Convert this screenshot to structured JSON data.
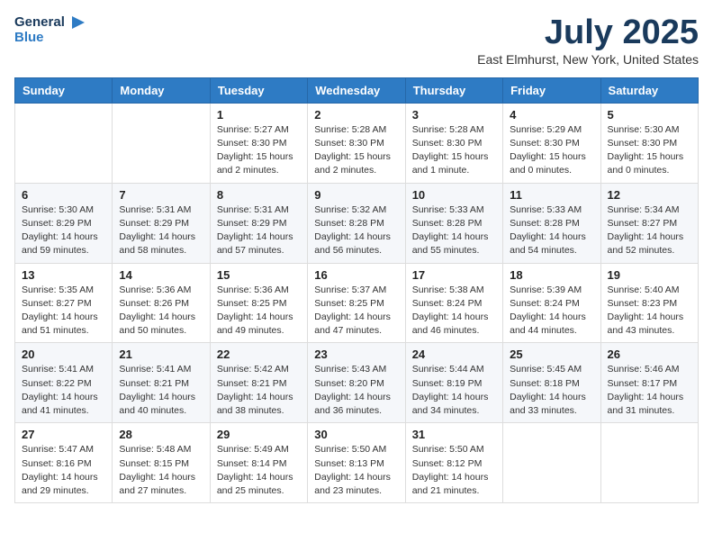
{
  "header": {
    "logo_line1": "General",
    "logo_line2": "Blue",
    "month_title": "July 2025",
    "location": "East Elmhurst, New York, United States"
  },
  "days_of_week": [
    "Sunday",
    "Monday",
    "Tuesday",
    "Wednesday",
    "Thursday",
    "Friday",
    "Saturday"
  ],
  "weeks": [
    [
      {
        "day": "",
        "info": ""
      },
      {
        "day": "",
        "info": ""
      },
      {
        "day": "1",
        "info": "Sunrise: 5:27 AM\nSunset: 8:30 PM\nDaylight: 15 hours and 2 minutes."
      },
      {
        "day": "2",
        "info": "Sunrise: 5:28 AM\nSunset: 8:30 PM\nDaylight: 15 hours and 2 minutes."
      },
      {
        "day": "3",
        "info": "Sunrise: 5:28 AM\nSunset: 8:30 PM\nDaylight: 15 hours and 1 minute."
      },
      {
        "day": "4",
        "info": "Sunrise: 5:29 AM\nSunset: 8:30 PM\nDaylight: 15 hours and 0 minutes."
      },
      {
        "day": "5",
        "info": "Sunrise: 5:30 AM\nSunset: 8:30 PM\nDaylight: 15 hours and 0 minutes."
      }
    ],
    [
      {
        "day": "6",
        "info": "Sunrise: 5:30 AM\nSunset: 8:29 PM\nDaylight: 14 hours and 59 minutes."
      },
      {
        "day": "7",
        "info": "Sunrise: 5:31 AM\nSunset: 8:29 PM\nDaylight: 14 hours and 58 minutes."
      },
      {
        "day": "8",
        "info": "Sunrise: 5:31 AM\nSunset: 8:29 PM\nDaylight: 14 hours and 57 minutes."
      },
      {
        "day": "9",
        "info": "Sunrise: 5:32 AM\nSunset: 8:28 PM\nDaylight: 14 hours and 56 minutes."
      },
      {
        "day": "10",
        "info": "Sunrise: 5:33 AM\nSunset: 8:28 PM\nDaylight: 14 hours and 55 minutes."
      },
      {
        "day": "11",
        "info": "Sunrise: 5:33 AM\nSunset: 8:28 PM\nDaylight: 14 hours and 54 minutes."
      },
      {
        "day": "12",
        "info": "Sunrise: 5:34 AM\nSunset: 8:27 PM\nDaylight: 14 hours and 52 minutes."
      }
    ],
    [
      {
        "day": "13",
        "info": "Sunrise: 5:35 AM\nSunset: 8:27 PM\nDaylight: 14 hours and 51 minutes."
      },
      {
        "day": "14",
        "info": "Sunrise: 5:36 AM\nSunset: 8:26 PM\nDaylight: 14 hours and 50 minutes."
      },
      {
        "day": "15",
        "info": "Sunrise: 5:36 AM\nSunset: 8:25 PM\nDaylight: 14 hours and 49 minutes."
      },
      {
        "day": "16",
        "info": "Sunrise: 5:37 AM\nSunset: 8:25 PM\nDaylight: 14 hours and 47 minutes."
      },
      {
        "day": "17",
        "info": "Sunrise: 5:38 AM\nSunset: 8:24 PM\nDaylight: 14 hours and 46 minutes."
      },
      {
        "day": "18",
        "info": "Sunrise: 5:39 AM\nSunset: 8:24 PM\nDaylight: 14 hours and 44 minutes."
      },
      {
        "day": "19",
        "info": "Sunrise: 5:40 AM\nSunset: 8:23 PM\nDaylight: 14 hours and 43 minutes."
      }
    ],
    [
      {
        "day": "20",
        "info": "Sunrise: 5:41 AM\nSunset: 8:22 PM\nDaylight: 14 hours and 41 minutes."
      },
      {
        "day": "21",
        "info": "Sunrise: 5:41 AM\nSunset: 8:21 PM\nDaylight: 14 hours and 40 minutes."
      },
      {
        "day": "22",
        "info": "Sunrise: 5:42 AM\nSunset: 8:21 PM\nDaylight: 14 hours and 38 minutes."
      },
      {
        "day": "23",
        "info": "Sunrise: 5:43 AM\nSunset: 8:20 PM\nDaylight: 14 hours and 36 minutes."
      },
      {
        "day": "24",
        "info": "Sunrise: 5:44 AM\nSunset: 8:19 PM\nDaylight: 14 hours and 34 minutes."
      },
      {
        "day": "25",
        "info": "Sunrise: 5:45 AM\nSunset: 8:18 PM\nDaylight: 14 hours and 33 minutes."
      },
      {
        "day": "26",
        "info": "Sunrise: 5:46 AM\nSunset: 8:17 PM\nDaylight: 14 hours and 31 minutes."
      }
    ],
    [
      {
        "day": "27",
        "info": "Sunrise: 5:47 AM\nSunset: 8:16 PM\nDaylight: 14 hours and 29 minutes."
      },
      {
        "day": "28",
        "info": "Sunrise: 5:48 AM\nSunset: 8:15 PM\nDaylight: 14 hours and 27 minutes."
      },
      {
        "day": "29",
        "info": "Sunrise: 5:49 AM\nSunset: 8:14 PM\nDaylight: 14 hours and 25 minutes."
      },
      {
        "day": "30",
        "info": "Sunrise: 5:50 AM\nSunset: 8:13 PM\nDaylight: 14 hours and 23 minutes."
      },
      {
        "day": "31",
        "info": "Sunrise: 5:50 AM\nSunset: 8:12 PM\nDaylight: 14 hours and 21 minutes."
      },
      {
        "day": "",
        "info": ""
      },
      {
        "day": "",
        "info": ""
      }
    ]
  ]
}
